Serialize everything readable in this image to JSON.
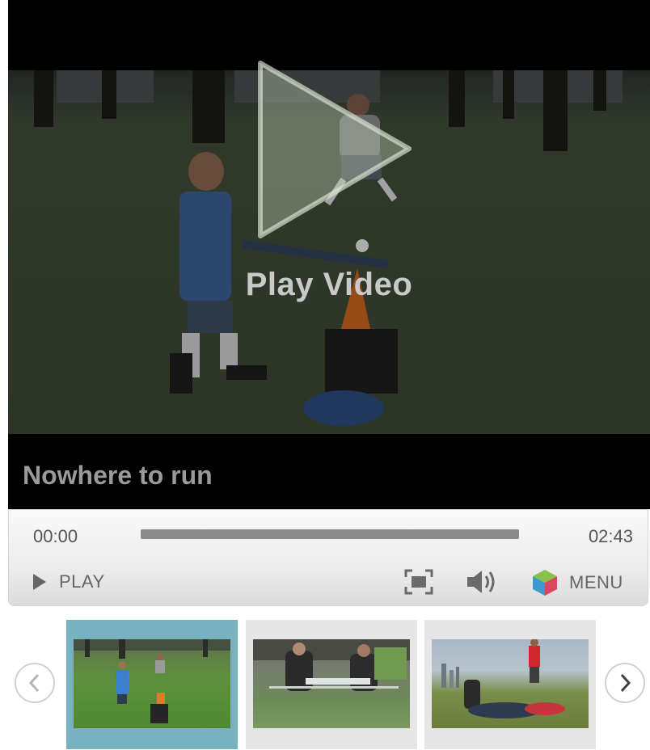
{
  "player": {
    "overlay_label": "Play Video",
    "title": "Nowhere to run"
  },
  "controls": {
    "current_time": "00:00",
    "duration": "02:43",
    "progress_percent": 0,
    "play_label": "PLAY",
    "menu_label": "MENU",
    "icons": [
      "play-icon",
      "fullscreen-icon",
      "volume-icon",
      "menu-cube-icon"
    ]
  },
  "thumbnails": {
    "active_index": 0,
    "items": [
      {
        "scene": "boy-batting-tee"
      },
      {
        "scene": "people-sitting-at-table"
      },
      {
        "scene": "city-skyline-park"
      }
    ],
    "prev_icon": "chevron-left-icon",
    "next_icon": "chevron-right-icon"
  },
  "colors": {
    "active_thumb_bg": "#78b2c1",
    "thumb_bg": "#e6e6e6",
    "player_bg": "#000000"
  }
}
